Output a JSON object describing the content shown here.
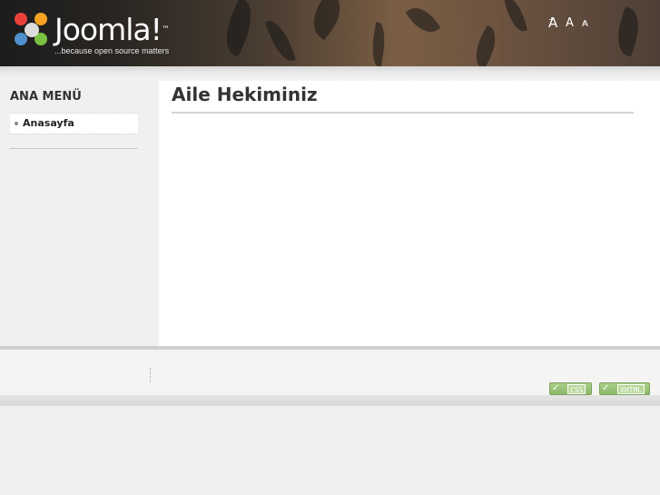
{
  "header": {
    "logo_word": "Joomla!",
    "logo_tm": "™",
    "tagline": "...because open source matters",
    "font_tools": {
      "increase": "A",
      "reset": "A",
      "decrease": "A"
    }
  },
  "sidebar": {
    "menu_title": "ANA MENÜ",
    "items": [
      {
        "label": "Anasayfa"
      }
    ]
  },
  "main": {
    "title": "Aile Hekiminiz"
  },
  "footer": {
    "badges": [
      {
        "label": "CSS"
      },
      {
        "label": "XHTML"
      }
    ]
  },
  "colors": {
    "badge_green": "#8cb86a",
    "header_dark": "#1c1c1c"
  }
}
